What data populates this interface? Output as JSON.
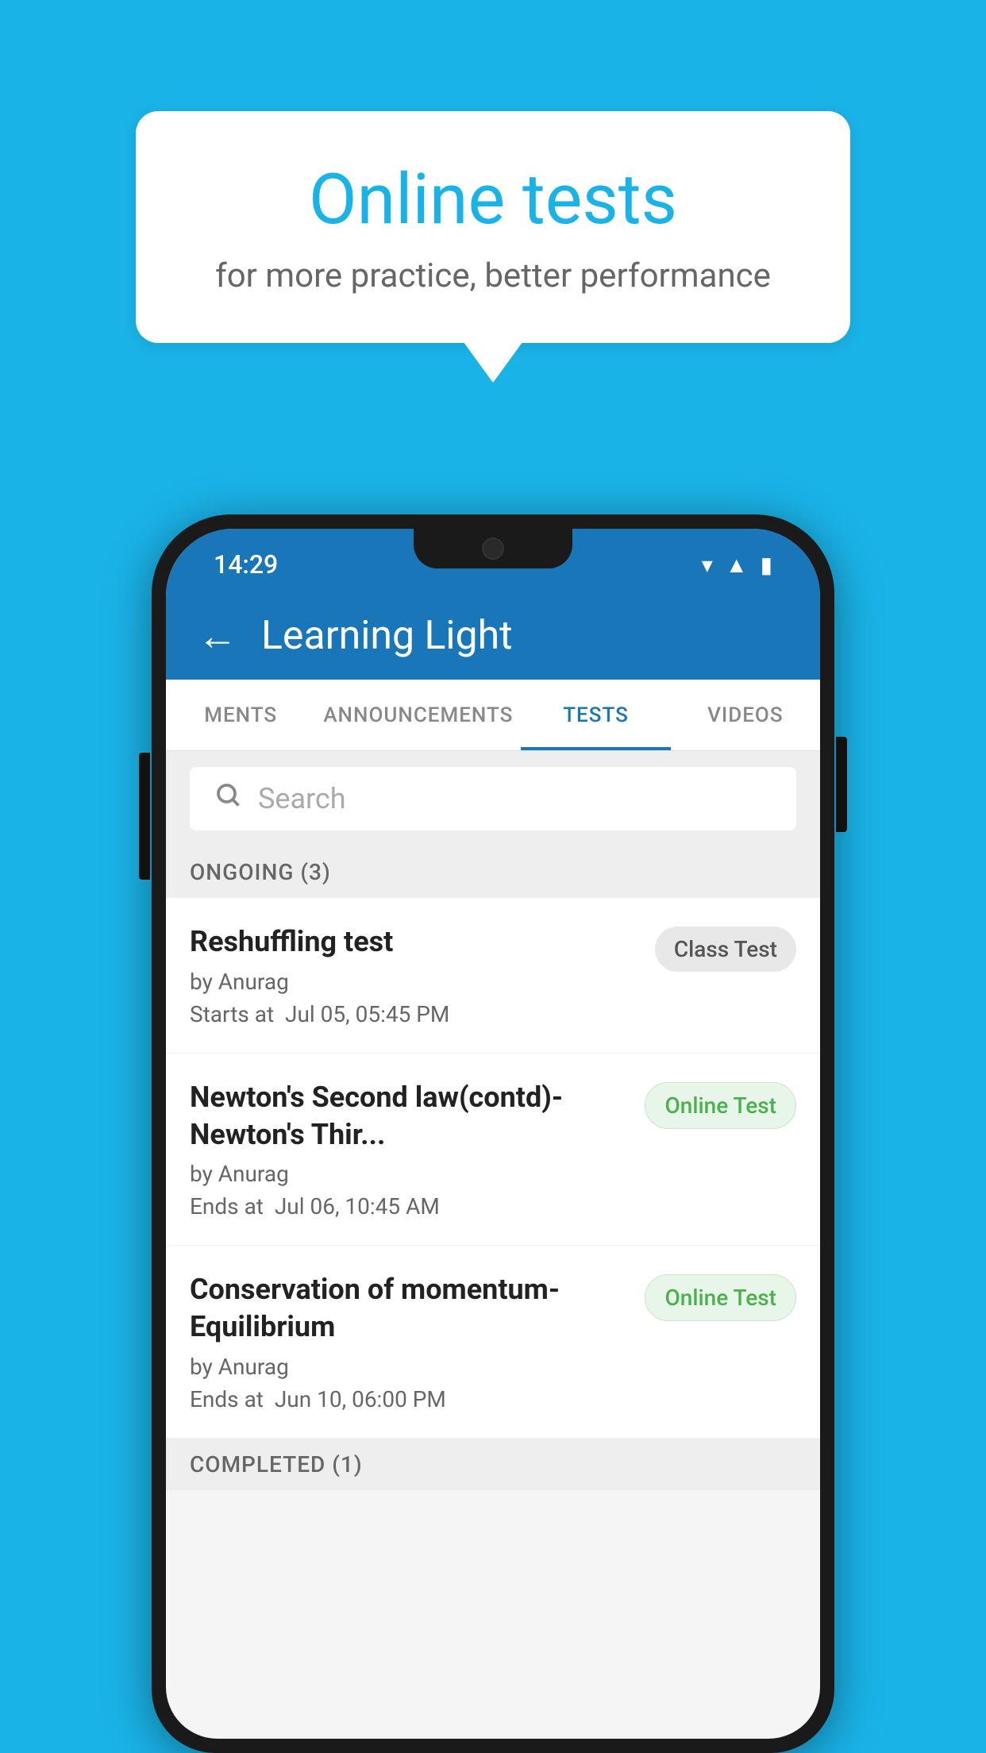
{
  "background_color": "#1ab3e8",
  "speech_bubble": {
    "title": "Online tests",
    "subtitle": "for more practice, better performance"
  },
  "status_bar": {
    "time": "14:29",
    "icons": [
      "wifi",
      "signal",
      "battery"
    ]
  },
  "app_bar": {
    "back_label": "←",
    "title": "Learning Light"
  },
  "tabs": [
    {
      "id": "ments",
      "label": "MENTS",
      "active": false
    },
    {
      "id": "announcements",
      "label": "ANNOUNCEMENTS",
      "active": false
    },
    {
      "id": "tests",
      "label": "TESTS",
      "active": true
    },
    {
      "id": "videos",
      "label": "VIDEOS",
      "active": false
    }
  ],
  "search": {
    "placeholder": "Search"
  },
  "ongoing_section": {
    "label": "ONGOING (3)"
  },
  "test_items": [
    {
      "id": "reshuffling",
      "name": "Reshuffling test",
      "author": "by Anurag",
      "time_label": "Starts at",
      "time_value": "Jul 05, 05:45 PM",
      "badge": "Class Test",
      "badge_type": "class"
    },
    {
      "id": "newton-second",
      "name": "Newton's Second law(contd)-Newton's Thir...",
      "author": "by Anurag",
      "time_label": "Ends at",
      "time_value": "Jul 06, 10:45 AM",
      "badge": "Online Test",
      "badge_type": "online"
    },
    {
      "id": "conservation",
      "name": "Conservation of momentum-Equilibrium",
      "author": "by Anurag",
      "time_label": "Ends at",
      "time_value": "Jun 10, 06:00 PM",
      "badge": "Online Test",
      "badge_type": "online"
    }
  ],
  "completed_section": {
    "label": "COMPLETED (1)"
  }
}
